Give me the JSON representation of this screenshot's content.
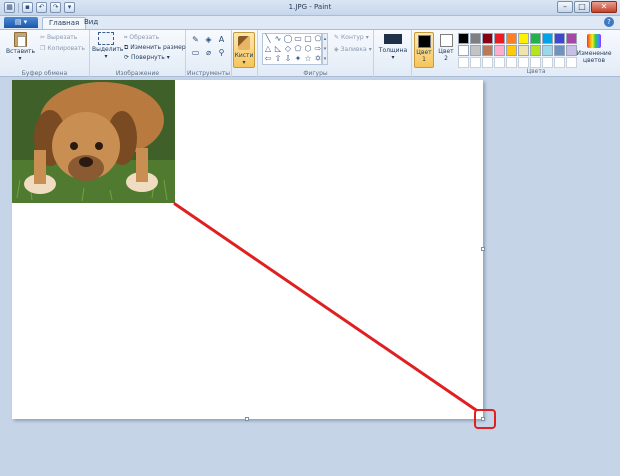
{
  "window": {
    "title": "1.JPG - Paint",
    "controls": {
      "minimize": "–",
      "maximize": "□",
      "close": "✕"
    }
  },
  "quick_access": [
    "save-icon",
    "undo-icon",
    "redo-icon",
    "customize-icon"
  ],
  "tabs": [
    {
      "label": "Главная",
      "active": true
    },
    {
      "label": "Вид",
      "active": false
    }
  ],
  "ribbon": {
    "clipboard": {
      "label": "Буфер обмена",
      "paste": "Вставить",
      "cut": "Вырезать",
      "copy": "Копировать"
    },
    "image": {
      "label": "Изображение",
      "select": "Выделить",
      "crop": "Обрезать",
      "resize": "Изменить размер",
      "rotate": "Повернуть"
    },
    "tools": {
      "label": "Инструменты"
    },
    "brushes": {
      "label": "Кисти"
    },
    "shapes": {
      "label": "Фигуры",
      "outline": "Контур",
      "fill": "Заливка"
    },
    "thickness": {
      "label": "Толщина"
    },
    "color1": {
      "label": "Цвет",
      "index": "1",
      "value": "#000000"
    },
    "color2": {
      "label": "Цвет",
      "index": "2",
      "value": "#ffffff"
    },
    "colors": {
      "label": "Цвета",
      "edit": "Изменение цветов",
      "palette": [
        "#000000",
        "#7f7f7f",
        "#880015",
        "#ed1c24",
        "#ff7f27",
        "#fff200",
        "#22b14c",
        "#00a2e8",
        "#3f48cc",
        "#a349a4",
        "#ffffff",
        "#c3c3c3",
        "#b97a57",
        "#ffaec9",
        "#ffc90e",
        "#efe4b0",
        "#b5e61d",
        "#99d9ea",
        "#7092be",
        "#c8bfe7",
        "#ffffff",
        "#ffffff",
        "#ffffff",
        "#ffffff",
        "#ffffff",
        "#ffffff",
        "#ffffff",
        "#ffffff",
        "#ffffff",
        "#ffffff"
      ]
    }
  },
  "annotation": {
    "color": "#e02020"
  }
}
